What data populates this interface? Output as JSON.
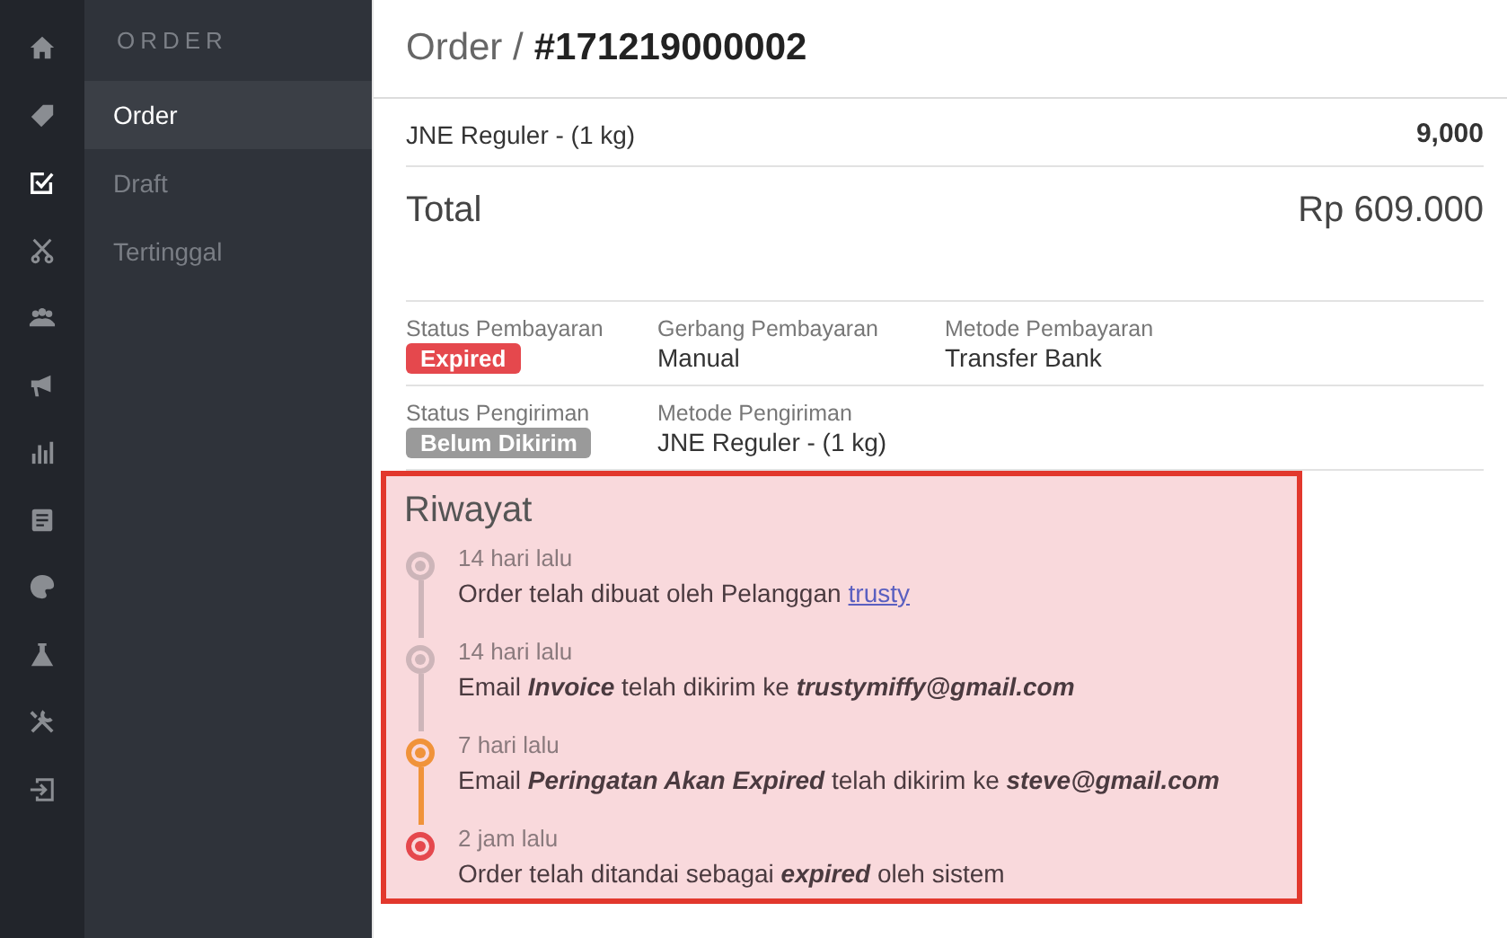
{
  "rail": [
    {
      "kind": "home",
      "selected": false
    },
    {
      "kind": "tag",
      "selected": false
    },
    {
      "kind": "checkbox",
      "selected": true
    },
    {
      "kind": "scissors",
      "selected": false
    },
    {
      "kind": "users",
      "selected": false
    },
    {
      "kind": "megaphone",
      "selected": false
    },
    {
      "kind": "chart",
      "selected": false
    },
    {
      "kind": "document",
      "selected": false
    },
    {
      "kind": "palette",
      "selected": false
    },
    {
      "kind": "flask",
      "selected": false
    },
    {
      "kind": "tools",
      "selected": false
    },
    {
      "kind": "signin",
      "selected": false
    }
  ],
  "subnav": {
    "heading": "ORDER",
    "items": [
      {
        "label": "Order",
        "selected": true
      },
      {
        "label": "Draft",
        "selected": false
      },
      {
        "label": "Tertinggal",
        "selected": false
      }
    ]
  },
  "header": {
    "prefix": "Order /",
    "number": "#171219000002"
  },
  "shipping_row": {
    "name": "JNE Reguler - (1 kg)",
    "amount": "9,000"
  },
  "total": {
    "label": "Total",
    "amount": "Rp 609.000"
  },
  "payment": [
    {
      "label": "Status Pembayaran",
      "badge": "Expired",
      "color": "#e5484d"
    },
    {
      "label": "Gerbang Pembayaran",
      "value": "Manual"
    },
    {
      "label": "Metode Pembayaran",
      "value": "Transfer Bank"
    }
  ],
  "shipment": [
    {
      "label": "Status Pengiriman",
      "badge": "Belum Dikirim",
      "color": "#9a9a9a"
    },
    {
      "label": "Metode Pengiriman",
      "value": "JNE Reguler - (1 kg)"
    }
  ],
  "history": {
    "title": "Riwayat",
    "items": [
      {
        "time": "14 hari lalu",
        "text": "Order telah dibuat oleh Pelanggan",
        "link": "trusty",
        "color": "#cdb5b9"
      },
      {
        "time": "14 hari lalu",
        "text": "Email **Invoice** telah dikirim ke **trustymiffy@gmail.com**",
        "color": "#cdb5b9"
      },
      {
        "time": "7 hari lalu",
        "text": "Email **Peringatan Akan Expired** telah dikirim ke **steve@gmail.com**",
        "color": "#f0933a"
      },
      {
        "time": "2 jam lalu",
        "text": "Order telah ditandai sebagai **expired** oleh sistem",
        "color": "#e5484d"
      }
    ]
  }
}
